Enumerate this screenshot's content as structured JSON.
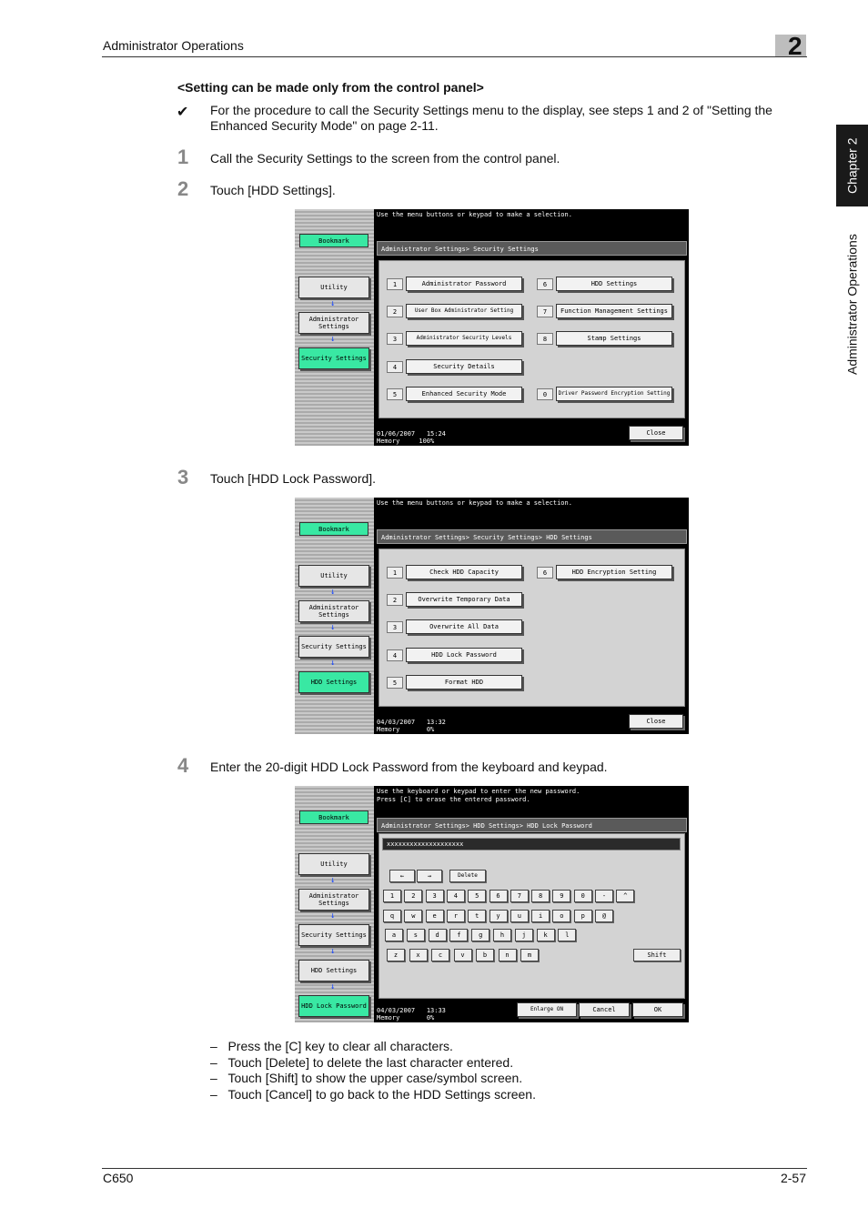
{
  "header": {
    "section_title": "Administrator Operations",
    "chapter_number": "2"
  },
  "side_tab": {
    "chapter": "Chapter 2",
    "section": "Administrator Operations"
  },
  "heading": "<Setting can be made only from the control panel>",
  "note": {
    "mark": "✔",
    "text_line1": "For the procedure to call the Security Settings menu to the display, see steps 1 and 2 of \"Setting the",
    "text_line2": "Enhanced Security Mode\" on page 2-11."
  },
  "steps": [
    {
      "num": "1",
      "text": "Call the Security Settings to the screen from the control panel."
    },
    {
      "num": "2",
      "text": "Touch [HDD Settings]."
    },
    {
      "num": "3",
      "text": "Touch [HDD Lock Password]."
    },
    {
      "num": "4",
      "text": "Enter the 20-digit HDD Lock Password from the keyboard and keypad."
    }
  ],
  "bullets": [
    "Press the [C] key to clear all characters.",
    "Touch [Delete] to delete the last character entered.",
    "Touch [Shift] to show the upper case/symbol screen.",
    "Touch [Cancel] to go back to the HDD Settings screen."
  ],
  "bullet_dash": "–",
  "screen1": {
    "message": "Use the menu buttons or keypad to make a selection.",
    "path": "Administrator Settings> Security Settings",
    "left": {
      "bookmark": "Bookmark",
      "utility": "Utility",
      "admin": "Administrator Settings",
      "security": "Security Settings"
    },
    "items": [
      {
        "n": "1",
        "label": "Administrator Password"
      },
      {
        "n": "2",
        "label": "User Box Administrator Setting"
      },
      {
        "n": "3",
        "label": "Administrator Security Levels"
      },
      {
        "n": "4",
        "label": "Security Details"
      },
      {
        "n": "5",
        "label": "Enhanced Security Mode"
      },
      {
        "n": "6",
        "label": "HDD Settings"
      },
      {
        "n": "7",
        "label": "Function Management Settings"
      },
      {
        "n": "8",
        "label": "Stamp Settings"
      },
      {
        "n": "0",
        "label": "Driver Password Encryption Setting"
      }
    ],
    "date": "01/06/2007",
    "time": "15:24",
    "memory_label": "Memory",
    "memory": "100%",
    "close": "Close"
  },
  "screen2": {
    "message": "Use the menu buttons or keypad to make a selection.",
    "path": "Administrator Settings> Security Settings> HDD Settings",
    "left": {
      "bookmark": "Bookmark",
      "utility": "Utility",
      "admin": "Administrator Settings",
      "security": "Security Settings",
      "hdd": "HDD Settings"
    },
    "items": [
      {
        "n": "1",
        "label": "Check HDD Capacity"
      },
      {
        "n": "2",
        "label": "Overwrite Temporary Data"
      },
      {
        "n": "3",
        "label": "Overwrite All Data"
      },
      {
        "n": "4",
        "label": "HDD Lock Password"
      },
      {
        "n": "5",
        "label": "Format HDD"
      },
      {
        "n": "6",
        "label": "HDD Encryption Setting"
      }
    ],
    "date": "04/03/2007",
    "time": "13:32",
    "memory_label": "Memory",
    "memory": "0%",
    "close": "Close"
  },
  "screen3": {
    "message_line1": "Use the keyboard or keypad to enter the new password.",
    "message_line2": "Press [C] to erase the entered password.",
    "path": "Administrator Settings> HDD Settings> HDD Lock Password",
    "password_value": "xxxxxxxxxxxxxxxxxxxx",
    "left": {
      "bookmark": "Bookmark",
      "utility": "Utility",
      "admin": "Administrator Settings",
      "security": "Security Settings",
      "hdd": "HDD Settings",
      "lock": "HDD Lock Password"
    },
    "nav_keys": {
      "left": "←",
      "right": "→",
      "delete": "Delete"
    },
    "row1": [
      "1",
      "2",
      "3",
      "4",
      "5",
      "6",
      "7",
      "8",
      "9",
      "0",
      "-",
      "^"
    ],
    "row2": [
      "q",
      "w",
      "e",
      "r",
      "t",
      "y",
      "u",
      "i",
      "o",
      "p",
      "@"
    ],
    "row3": [
      "a",
      "s",
      "d",
      "f",
      "g",
      "h",
      "j",
      "k",
      "l"
    ],
    "row4": [
      "z",
      "x",
      "c",
      "v",
      "b",
      "n",
      "m",
      ".",
      "/"
    ],
    "shift": "Shift",
    "date": "04/03/2007",
    "time": "13:33",
    "memory_label": "Memory",
    "memory": "0%",
    "enlarge": "Enlarge ON",
    "cancel": "Cancel",
    "ok": "OK"
  },
  "footer": {
    "model": "C650",
    "page": "2-57"
  }
}
